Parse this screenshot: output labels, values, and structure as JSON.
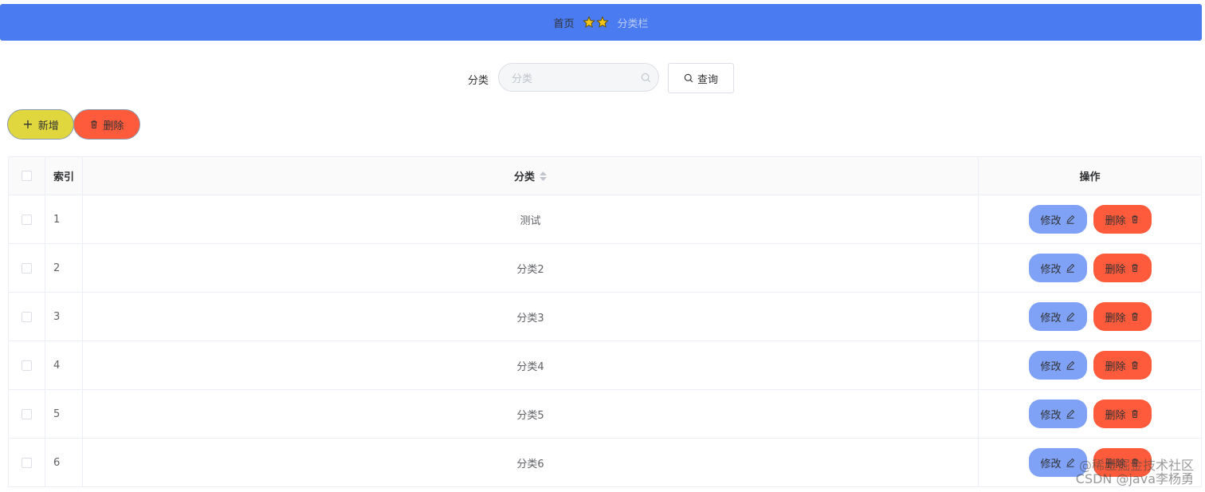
{
  "header": {
    "breadcrumb_home": "首页",
    "breadcrumb_current": "分类栏",
    "background_color": "#4b7bf0"
  },
  "search": {
    "label": "分类",
    "placeholder": "分类",
    "value": "",
    "query_label": "查询"
  },
  "actions": {
    "add_label": "新增",
    "delete_label": "删除",
    "add_color": "#e0d63d",
    "delete_color": "#fd5b3b"
  },
  "table": {
    "columns": [
      "索引",
      "分类",
      "操作"
    ],
    "rows": [
      {
        "index": "1",
        "category": "测试"
      },
      {
        "index": "2",
        "category": "分类2"
      },
      {
        "index": "3",
        "category": "分类3"
      },
      {
        "index": "4",
        "category": "分类4"
      },
      {
        "index": "5",
        "category": "分类5"
      },
      {
        "index": "6",
        "category": "分类6"
      }
    ],
    "edit_label": "修改",
    "delete_label": "删除",
    "edit_color": "#7fa1f6",
    "delete_color": "#fd5b3b"
  },
  "icons": [
    "star-icon",
    "search-icon",
    "plus-icon",
    "trash-icon",
    "sort-icon",
    "edit-icon"
  ],
  "watermark": {
    "line1": "@稀土掘金技术社区",
    "line2": "CSDN @java李杨勇"
  }
}
